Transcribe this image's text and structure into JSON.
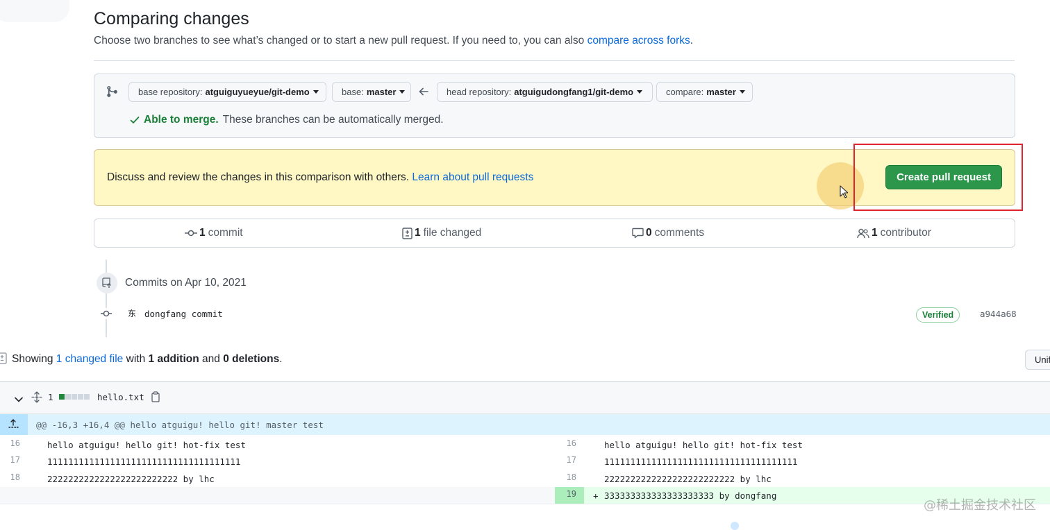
{
  "header": {
    "title": "Comparing changes",
    "subtitle": "Choose two branches to see what’s changed or to start a new pull request. If you need to, you can also",
    "compare_forks_link": "compare across forks",
    "subtitle_end": "."
  },
  "range": {
    "base_repo_label": "base repository:",
    "base_repo_value": "atguiguyueyue/git-demo",
    "base_label": "base:",
    "base_value": "master",
    "head_repo_label": "head repository:",
    "head_repo_value": "atguigudongfang1/git-demo",
    "compare_label": "compare:",
    "compare_value": "master",
    "merge_status": "Able to merge.",
    "merge_detail": "These branches can be automatically merged."
  },
  "flash": {
    "text": "Discuss and review the changes in this comparison with others.",
    "link": "Learn about pull requests",
    "create_button": "Create pull request"
  },
  "stats": {
    "commits_count": "1",
    "commits_label": "commit",
    "files_count": "1",
    "files_label": "file changed",
    "comments_count": "0",
    "comments_label": "comments",
    "contributors_count": "1",
    "contributors_label": "contributor"
  },
  "commits": {
    "heading": "Commits on Apr 10, 2021",
    "items": [
      {
        "avatar": "东",
        "message": "dongfang commit",
        "badge": "Verified",
        "sha": "a944a68"
      }
    ]
  },
  "summary": {
    "showing": "Showing",
    "changed_link": "1 changed file",
    "with": "with",
    "additions": "1 addition",
    "and": "and",
    "deletions": "0 deletions",
    "end": ".",
    "unified_button": "Unified"
  },
  "file": {
    "change_count": "1",
    "name": "hello.txt",
    "hunk": "@@ -16,3 +16,4 @@ hello atguigu! hello git! master test",
    "left_lines": [
      {
        "num": "16",
        "text": "hello atguigu! hello git! hot-fix test"
      },
      {
        "num": "17",
        "text": "1111111111111111111111111111111111111"
      },
      {
        "num": "18",
        "text": "2222222222222222222222222 by lhc"
      }
    ],
    "right_lines": [
      {
        "num": "16",
        "text": "hello atguigu! hello git! hot-fix test"
      },
      {
        "num": "17",
        "text": "1111111111111111111111111111111111111"
      },
      {
        "num": "18",
        "text": "2222222222222222222222222 by lhc"
      },
      {
        "num": "19",
        "text": "333333333333333333333 by dongfang",
        "marker": "+"
      }
    ]
  },
  "watermark": "@稀土掘金技术社区",
  "colors": {
    "primary_button": "#2c974b",
    "link": "#0969da",
    "success": "#1a7f37",
    "flash_bg": "#fff8c5",
    "highlight_box": "#e0232f",
    "addition_bg": "#e6ffec"
  }
}
